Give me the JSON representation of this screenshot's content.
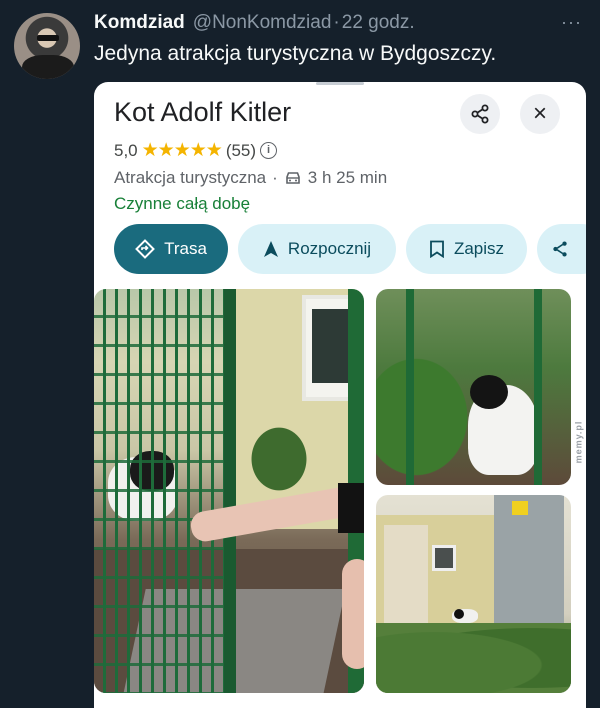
{
  "tweet": {
    "author_name": "Komdziad",
    "author_handle": "@NonKomdziad",
    "separator": "·",
    "time": "22 godz.",
    "more": "···",
    "text": "Jedyna atrakcja turystyczna w Bydgoszczy."
  },
  "place": {
    "title": "Kot Adolf Kitler",
    "rating": "5,0",
    "stars": "★★★★★",
    "review_count": "(55)",
    "info": "i",
    "category": "Atrakcja turystyczna",
    "dot": "·",
    "drive_time": "3 h 25 min",
    "open_status": "Czynne całą dobę",
    "close_symbol": "×"
  },
  "actions": {
    "route": "Trasa",
    "start": "Rozpocznij",
    "save": "Zapisz"
  },
  "watermark": "memy.pl",
  "colors": {
    "background": "#15202b",
    "accent_teal": "#1a6b7e",
    "chip_bg": "#d9f1f7",
    "open_green": "#188038",
    "star_yellow": "#f4b400"
  }
}
